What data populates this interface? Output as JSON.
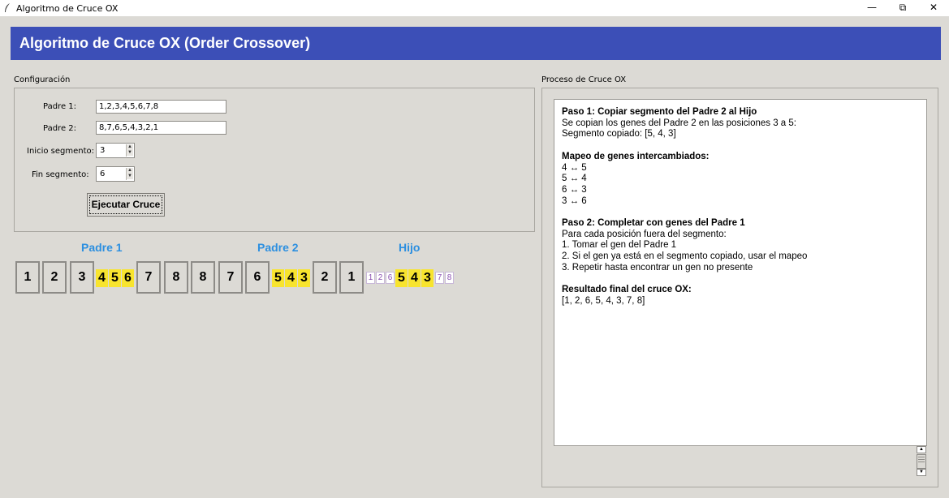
{
  "window": {
    "title": "Algoritmo de Cruce OX",
    "minimize": "—",
    "restore": "⧉",
    "close": "✕"
  },
  "banner": {
    "title": "Algoritmo de Cruce OX (Order Crossover)"
  },
  "config": {
    "section_label": "Configuración",
    "padre1_label": "Padre 1:",
    "padre1_value": "1,2,3,4,5,6,7,8",
    "padre2_label": "Padre 2:",
    "padre2_value": "8,7,6,5,4,3,2,1",
    "inicio_label": "Inicio segmento:",
    "inicio_value": "3",
    "fin_label": "Fin segmento:",
    "fin_value": "6",
    "run_button": "Ejecutar Cruce"
  },
  "genes": {
    "padre1_title": "Padre 1",
    "padre2_title": "Padre 2",
    "hijo_title": "Hijo",
    "padre1": {
      "before": [
        "1",
        "2",
        "3"
      ],
      "segment": [
        "4",
        "5",
        "6"
      ],
      "after": [
        "7",
        "8"
      ]
    },
    "padre2": {
      "before": [
        "8",
        "7",
        "6"
      ],
      "segment": [
        "5",
        "4",
        "3"
      ],
      "after": [
        "2",
        "1"
      ]
    },
    "hijo": {
      "before": [
        "1",
        "2",
        "6"
      ],
      "segment": [
        "5",
        "4",
        "3"
      ],
      "after": [
        "7",
        "8"
      ]
    },
    "highlight_color": "#f8e42e",
    "title_color": "#2c8fe0"
  },
  "process": {
    "section_label": "Proceso de Cruce OX",
    "step1_title": "Paso 1: Copiar segmento del Padre 2 al Hijo",
    "step1_lines": [
      "Se copian los genes del Padre 2 en las posiciones 3 a 5:",
      "Segmento copiado: [5, 4, 3]"
    ],
    "mapping_title": "Mapeo de genes intercambiados:",
    "mapping_lines": [
      "4 ↔ 5",
      "5 ↔ 4",
      "6 ↔ 3",
      "3 ↔ 6"
    ],
    "step2_title": "Paso 2: Completar con genes del Padre 1",
    "step2_lines": [
      "Para cada posición fuera del segmento:",
      "1. Tomar el gen del Padre 1",
      "2. Si el gen ya está en el segmento copiado, usar el mapeo",
      "3. Repetir hasta encontrar un gen no presente"
    ],
    "result_title": "Resultado final del cruce OX:",
    "result_value": "[1, 2, 6, 5, 4, 3, 7, 8]"
  },
  "colors": {
    "banner": "#3c4fb7",
    "background": "#dcdad5"
  }
}
